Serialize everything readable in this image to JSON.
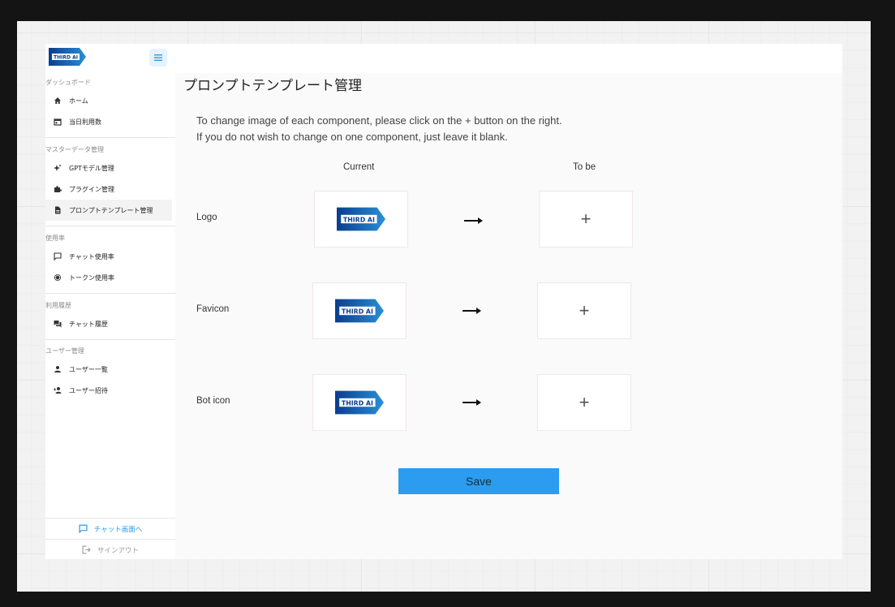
{
  "brand": {
    "logo_text": "THIRD AI"
  },
  "sidebar": {
    "sections": [
      {
        "title": "ダッシュボード",
        "items": [
          {
            "label": "ホーム",
            "icon": "home-icon"
          },
          {
            "label": "当日利用数",
            "icon": "calendar-icon"
          }
        ]
      },
      {
        "title": "マスターデータ管理",
        "items": [
          {
            "label": "GPTモデル管理",
            "icon": "sparkle-icon"
          },
          {
            "label": "プラグイン管理",
            "icon": "puzzle-icon"
          },
          {
            "label": "プロンプトテンプレート管理",
            "icon": "document-icon"
          }
        ]
      },
      {
        "title": "使用率",
        "items": [
          {
            "label": "チャット使用率",
            "icon": "chat-icon"
          },
          {
            "label": "トークン使用率",
            "icon": "token-icon"
          }
        ]
      },
      {
        "title": "利用履歴",
        "items": [
          {
            "label": "チャット履歴",
            "icon": "chat-history-icon"
          }
        ]
      },
      {
        "title": "ユーザー管理",
        "items": [
          {
            "label": "ユーザー一覧",
            "icon": "person-icon"
          },
          {
            "label": "ユーザー招待",
            "icon": "person-add-icon"
          }
        ]
      }
    ],
    "chat_link": "チャット画面へ",
    "signout": "サインアウト"
  },
  "main": {
    "title": "プロンプトテンプレート管理",
    "intro_line1": "To change image of each component, please click on the + button on the right.",
    "intro_line2": "If you do not wish to change on one component, just leave it blank.",
    "col_current": "Current",
    "col_tobe": "To be",
    "rows": [
      {
        "label": "Logo"
      },
      {
        "label": "Favicon"
      },
      {
        "label": "Bot icon"
      }
    ],
    "plus": "+",
    "save": "Save"
  },
  "colors": {
    "accent": "#2b9cef",
    "logo_dark": "#0a3d8f",
    "logo_light": "#2a8fd6"
  }
}
